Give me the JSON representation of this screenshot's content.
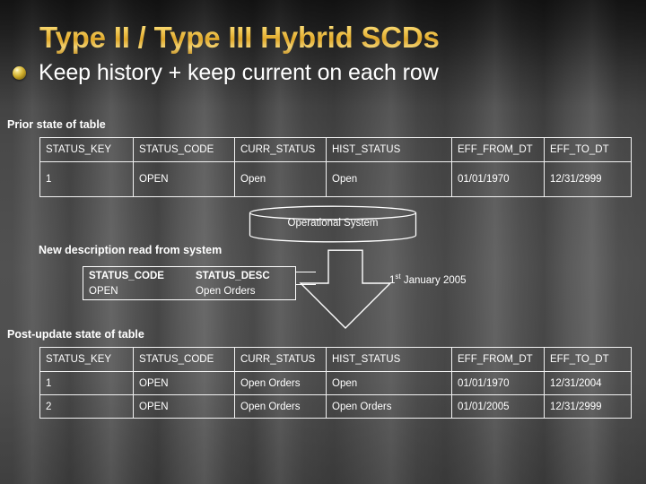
{
  "slide": {
    "title": "Type II / Type III Hybrid SCDs",
    "bullet": "Keep history + keep current on each row",
    "bullet_icon": "gold-sphere-bullet-icon",
    "title_color": "#e8b93a",
    "text_color": "#ffffff",
    "background_color": "#4a4a4a"
  },
  "prior_section": {
    "caption": "Prior state of table",
    "columns": [
      "STATUS_KEY",
      "STATUS_CODE",
      "CURR_STATUS",
      "HIST_STATUS",
      "EFF_FROM_DT",
      "EFF_TO_DT"
    ],
    "rows": [
      [
        "1",
        "OPEN",
        "Open",
        "Open",
        "01/01/1970",
        "12/31/2999"
      ]
    ]
  },
  "source_system": {
    "label": "Operational System",
    "icon": "database-cylinder-icon"
  },
  "new_description": {
    "caption": "New description read from system",
    "columns": [
      "STATUS_CODE",
      "STATUS_DESC"
    ],
    "rows": [
      [
        "OPEN",
        "Open Orders"
      ]
    ]
  },
  "flow": {
    "arrow_icon": "down-arrow-icon",
    "connector_icon": "connector-line-icon",
    "date_prefix": "1",
    "date_ordinal": "st",
    "date_suffix": " January 2005"
  },
  "post_section": {
    "caption": "Post-update state of table",
    "columns": [
      "STATUS_KEY",
      "STATUS_CODE",
      "CURR_STATUS",
      "HIST_STATUS",
      "EFF_FROM_DT",
      "EFF_TO_DT"
    ],
    "rows": [
      [
        "1",
        "OPEN",
        "Open Orders",
        "Open",
        "01/01/1970",
        "12/31/2004"
      ],
      [
        "2",
        "OPEN",
        "Open Orders",
        "Open Orders",
        "01/01/2005",
        "12/31/2999"
      ]
    ]
  }
}
